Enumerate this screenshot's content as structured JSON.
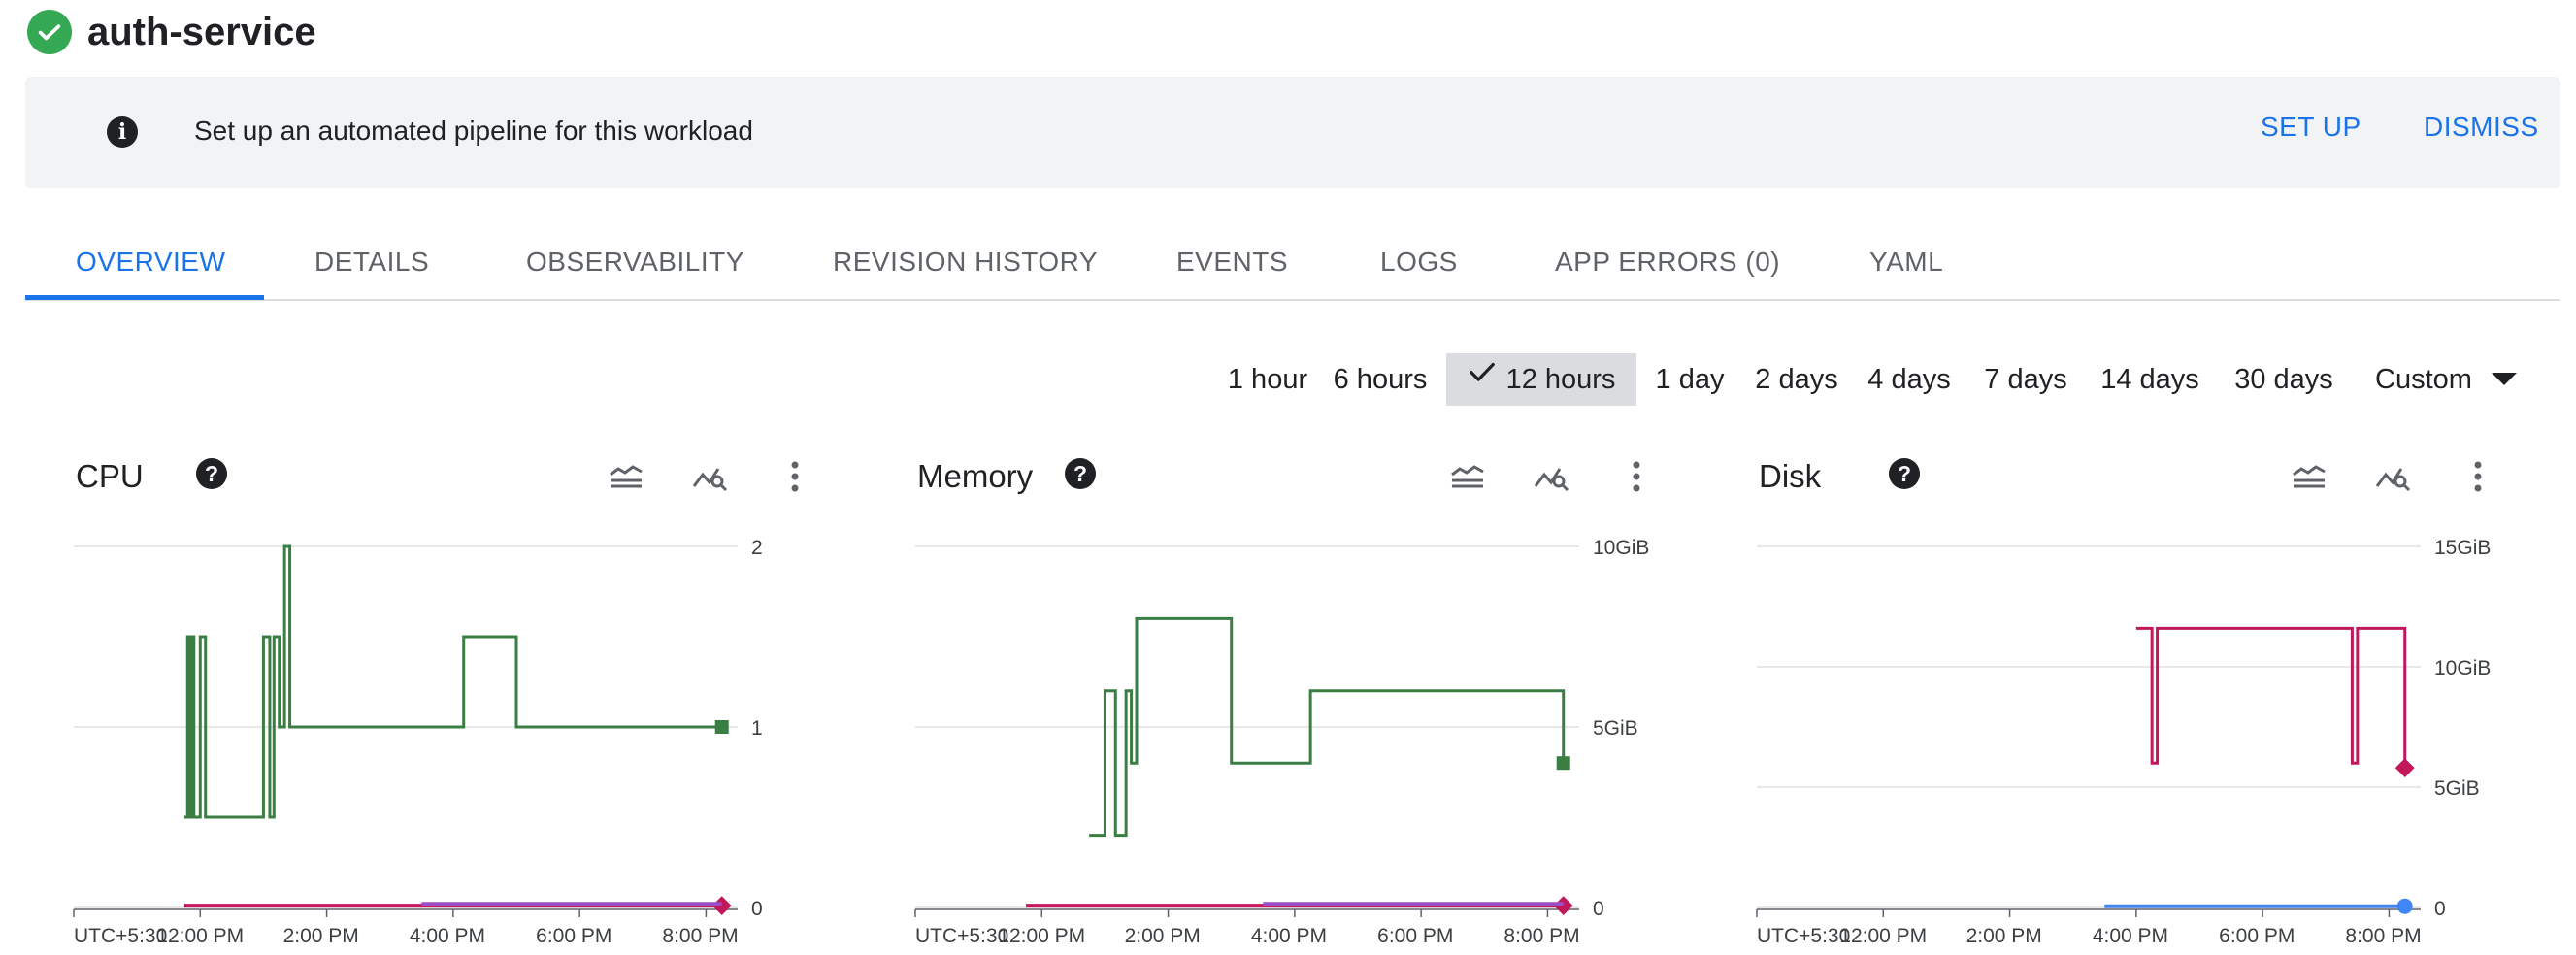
{
  "header": {
    "title": "auth-service",
    "status_icon": "check-circle-icon",
    "status_color": "#34a853"
  },
  "banner": {
    "icon": "info-icon",
    "text": "Set up an automated pipeline for this workload",
    "setup_label": "SET UP",
    "dismiss_label": "DISMISS"
  },
  "tabs": [
    {
      "label": "OVERVIEW",
      "active": true
    },
    {
      "label": "DETAILS"
    },
    {
      "label": "OBSERVABILITY"
    },
    {
      "label": "REVISION HISTORY"
    },
    {
      "label": "EVENTS"
    },
    {
      "label": "LOGS"
    },
    {
      "label": "APP ERRORS (0)"
    },
    {
      "label": "YAML"
    }
  ],
  "time_ranges": {
    "options": [
      "1 hour",
      "6 hours",
      "12 hours",
      "1 day",
      "2 days",
      "4 days",
      "7 days",
      "14 days",
      "30 days"
    ],
    "selected": "12 hours",
    "custom_label": "Custom"
  },
  "colors": {
    "accent": "#1a73e8",
    "green": "#3a7e44",
    "crimson": "#c2185b",
    "purple": "#9c4fc4",
    "blue": "#4285f4"
  },
  "chart_data": [
    {
      "type": "line",
      "title": "CPU",
      "x_ticks": [
        "UTC+5:30",
        "12:00 PM",
        "2:00 PM",
        "4:00 PM",
        "6:00 PM",
        "8:00 PM"
      ],
      "y_ticks": [
        "0",
        "1",
        "2"
      ],
      "ylim": [
        0,
        2
      ],
      "series": [
        {
          "color": "#3a7e44",
          "x": [
            "11:45 AM",
            "11:48 AM",
            "11:50 AM",
            "11:52 AM",
            "11:54 AM",
            "12:00 PM",
            "12:05 PM",
            "1:00 PM",
            "1:06 PM",
            "1:10 PM",
            "1:15 PM",
            "1:20 PM",
            "1:25 PM",
            "1:30 PM",
            "3:20 PM",
            "3:45 PM",
            "4:00 PM",
            "4:10 PM",
            "5:00 PM",
            "8:15 PM"
          ],
          "y": [
            0.5,
            1.5,
            0.5,
            1.5,
            0.5,
            1.5,
            0.5,
            1.5,
            0.5,
            1.5,
            1.0,
            2.0,
            1.0,
            1.0,
            1.0,
            1.0,
            1.0,
            1.5,
            1.0,
            1.0
          ]
        },
        {
          "color": "#c2185b",
          "x": [
            "11:45 AM",
            "8:15 PM"
          ],
          "y": [
            0.01,
            0.01
          ]
        },
        {
          "color": "#9c4fc4",
          "x": [
            "3:30 PM",
            "8:15 PM"
          ],
          "y": [
            0.02,
            0.02
          ]
        }
      ]
    },
    {
      "type": "line",
      "title": "Memory",
      "x_ticks": [
        "UTC+5:30",
        "12:00 PM",
        "2:00 PM",
        "4:00 PM",
        "6:00 PM",
        "8:00 PM"
      ],
      "y_ticks": [
        "0",
        "5GiB",
        "10GiB"
      ],
      "ylim": [
        0,
        10
      ],
      "series": [
        {
          "color": "#3a7e44",
          "x": [
            "12:45 PM",
            "1:00 PM",
            "1:10 PM",
            "1:20 PM",
            "1:25 PM",
            "1:30 PM",
            "3:00 PM",
            "4:00 PM",
            "4:15 PM",
            "8:15 PM"
          ],
          "y": [
            2.0,
            6.0,
            2.0,
            6.0,
            4.0,
            8.0,
            4.0,
            4.0,
            6.0,
            4.0
          ]
        },
        {
          "color": "#c2185b",
          "x": [
            "11:45 AM",
            "8:15 PM"
          ],
          "y": [
            0.05,
            0.05
          ]
        },
        {
          "color": "#9c4fc4",
          "x": [
            "3:30 PM",
            "8:15 PM"
          ],
          "y": [
            0.1,
            0.1
          ]
        }
      ]
    },
    {
      "type": "line",
      "title": "Disk",
      "x_ticks": [
        "UTC+5:30",
        "12:00 PM",
        "2:00 PM",
        "4:00 PM",
        "6:00 PM",
        "8:00 PM"
      ],
      "y_ticks": [
        "5GiB",
        "10GiB",
        "15GiB"
      ],
      "ylim": [
        0,
        15
      ],
      "series": [
        {
          "color": "#c2185b",
          "x": [
            "4:00 PM",
            "4:10 PM",
            "4:15 PM",
            "4:20 PM",
            "7:20 PM",
            "7:25 PM",
            "7:30 PM",
            "8:15 PM"
          ],
          "y": [
            11.6,
            11.6,
            6.0,
            11.6,
            11.6,
            6.0,
            11.6,
            5.8
          ]
        },
        {
          "color": "#4285f4",
          "x": [
            "3:30 PM",
            "8:15 PM"
          ],
          "y": [
            0.05,
            0.05
          ]
        }
      ]
    }
  ]
}
